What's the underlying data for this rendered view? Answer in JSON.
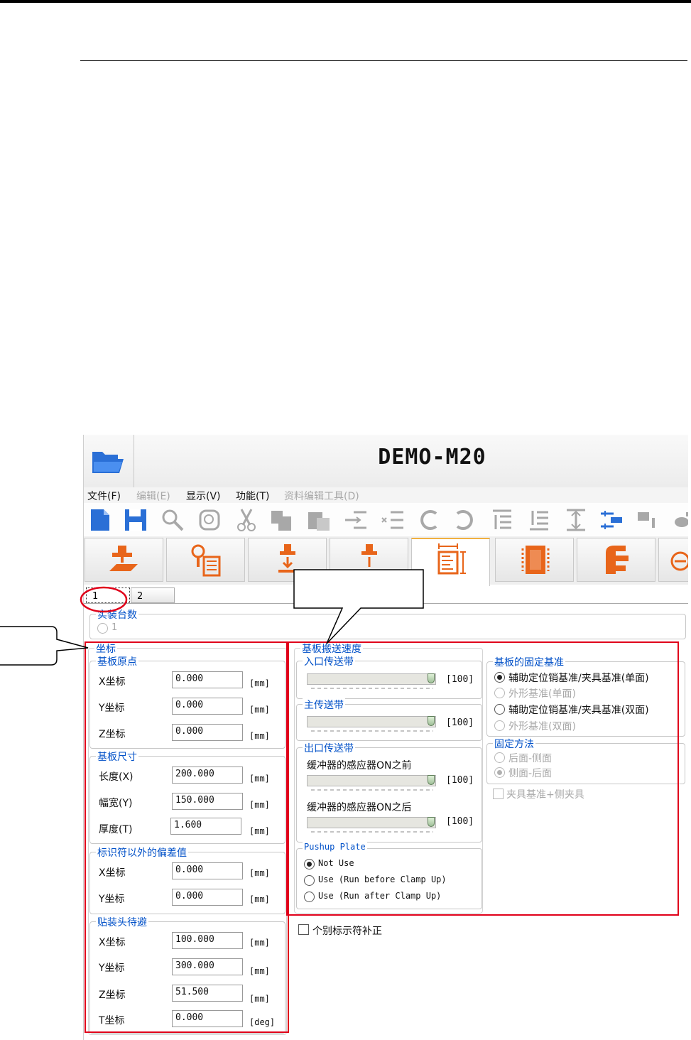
{
  "window": {
    "title": "DEMO-M20"
  },
  "menu": [
    {
      "label": "文件(F)",
      "enabled": true
    },
    {
      "label": "编辑(E)",
      "enabled": false
    },
    {
      "label": "显示(V)",
      "enabled": true
    },
    {
      "label": "功能(T)",
      "enabled": true
    },
    {
      "label": "资料编辑工具(D)",
      "enabled": false
    }
  ],
  "toolbar_icons": [
    "new-file-icon",
    "save-icon",
    "search-icon",
    "find-replace-icon",
    "cut-icon",
    "copy-icon",
    "paste-icon",
    "insert-after-icon",
    "insert-before-icon",
    "undo-icon",
    "redo-icon",
    "move-up-icon",
    "move-down-icon",
    "sort-icon",
    "transfer-icon",
    "component-icon",
    "nozzle-icon"
  ],
  "mode_tabs": [
    "pickup-tab",
    "vision-tab",
    "placement-tab",
    "head-tab",
    "board-tab",
    "component-tab",
    "feeder-tab",
    "misc-tab"
  ],
  "sub_tabs": [
    "1",
    "2"
  ],
  "mount_count": {
    "label": "实装台数",
    "option": "1"
  },
  "coordinates": {
    "title": "坐标",
    "origin": {
      "title": "基板原点",
      "fields": [
        {
          "label": "X坐标",
          "value": "0.000",
          "unit": "[mm]"
        },
        {
          "label": "Y坐标",
          "value": "0.000",
          "unit": "[mm]"
        },
        {
          "label": "Z坐标",
          "value": "0.000",
          "unit": "[mm]"
        }
      ]
    },
    "size": {
      "title": "基板尺寸",
      "fields": [
        {
          "label": "长度(X)",
          "value": "200.000",
          "unit": "[mm]"
        },
        {
          "label": "幅宽(Y)",
          "value": "150.000",
          "unit": "[mm]"
        },
        {
          "label": "厚度(T)",
          "value": "1.600",
          "unit": "[mm]"
        }
      ]
    },
    "offset": {
      "title": "标识符以外的偏差值",
      "fields": [
        {
          "label": "X坐标",
          "value": "0.000",
          "unit": "[mm]"
        },
        {
          "label": "Y坐标",
          "value": "0.000",
          "unit": "[mm]"
        }
      ]
    },
    "head_wait": {
      "title": "贴装头待避",
      "fields": [
        {
          "label": "X坐标",
          "value": "100.000",
          "unit": "[mm]"
        },
        {
          "label": "Y坐标",
          "value": "300.000",
          "unit": "[mm]"
        },
        {
          "label": "Z坐标",
          "value": "51.500",
          "unit": "[mm]"
        },
        {
          "label": "T坐标",
          "value": "0.000",
          "unit": "[deg]"
        }
      ]
    }
  },
  "speed": {
    "title": "基板搬送速度",
    "entry": {
      "title": "入口传送带",
      "value": "[100]",
      "level": 1.0
    },
    "main": {
      "title": "主传送带",
      "value": "[100]",
      "level": 1.0
    },
    "exit": {
      "title": "出口传送带",
      "before": {
        "label": "缓冲器的感应器ON之前",
        "value": "[100]",
        "level": 1.0
      },
      "after": {
        "label": "缓冲器的感应器ON之后",
        "value": "[100]",
        "level": 1.0
      }
    },
    "pushup": {
      "title": "Pushup Plate",
      "options": [
        {
          "label": "Not Use",
          "selected": true
        },
        {
          "label": "Use (Run before Clamp Up)",
          "selected": false
        },
        {
          "label": "Use (Run after Clamp Up)",
          "selected": false
        }
      ]
    }
  },
  "fix_ref": {
    "title": "基板的固定基准",
    "options": [
      {
        "label": "辅助定位销基准/夹具基准(单面)",
        "selected": true,
        "enabled": true
      },
      {
        "label": "外形基准(单面)",
        "selected": false,
        "enabled": false
      },
      {
        "label": "辅助定位销基准/夹具基准(双面)",
        "selected": false,
        "enabled": true
      },
      {
        "label": "外形基准(双面)",
        "selected": false,
        "enabled": false
      }
    ]
  },
  "fix_method": {
    "title": "固定方法",
    "options": [
      {
        "label": "后面-侧面",
        "selected": false
      },
      {
        "label": "侧面-后面",
        "selected": true
      }
    ]
  },
  "clamp_check": {
    "label": "夹具基准+侧夹具"
  },
  "individual_check": {
    "label": "个别标示符补正"
  },
  "colors": {
    "highlight": "#e0001a",
    "group_title": "#0050c8",
    "icon_blue": "#2a6fd6"
  }
}
